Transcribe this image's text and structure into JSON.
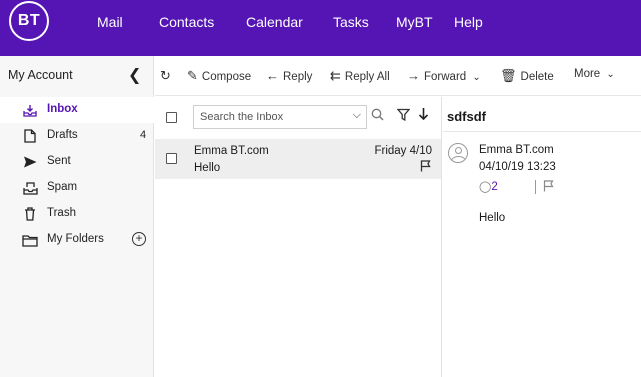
{
  "brand": {
    "logo_text": "BT",
    "color": "#5514b4"
  },
  "nav": [
    "Mail",
    "Contacts",
    "Calendar",
    "Tasks",
    "MyBT",
    "Help"
  ],
  "sidebar": {
    "title": "My Account",
    "collapse_icon": "chevron-left-icon",
    "folders": [
      {
        "label": "Inbox",
        "icon": "inbox-icon",
        "count": "",
        "active": true
      },
      {
        "label": "Drafts",
        "icon": "draft-icon",
        "count": "4"
      },
      {
        "label": "Sent",
        "icon": "sent-icon",
        "count": ""
      },
      {
        "label": "Spam",
        "icon": "spam-icon",
        "count": ""
      },
      {
        "label": "Trash",
        "icon": "trash-icon",
        "count": ""
      },
      {
        "label": "My Folders",
        "icon": "folder-icon",
        "count": ""
      }
    ]
  },
  "toolbar": {
    "compose": "Compose",
    "reply": "Reply",
    "reply_all": "Reply All",
    "forward": "Forward",
    "delete": "Delete",
    "more": "More"
  },
  "list": {
    "search_placeholder": "Search the Inbox",
    "messages": [
      {
        "from": "Emma BT.com",
        "subject": "Hello",
        "date": "Friday 4/10"
      }
    ]
  },
  "reader": {
    "subject": "sdfsdf",
    "from": "Emma BT.com",
    "date": "04/10/19 13:23",
    "recipients": "2",
    "body": "Hello"
  }
}
